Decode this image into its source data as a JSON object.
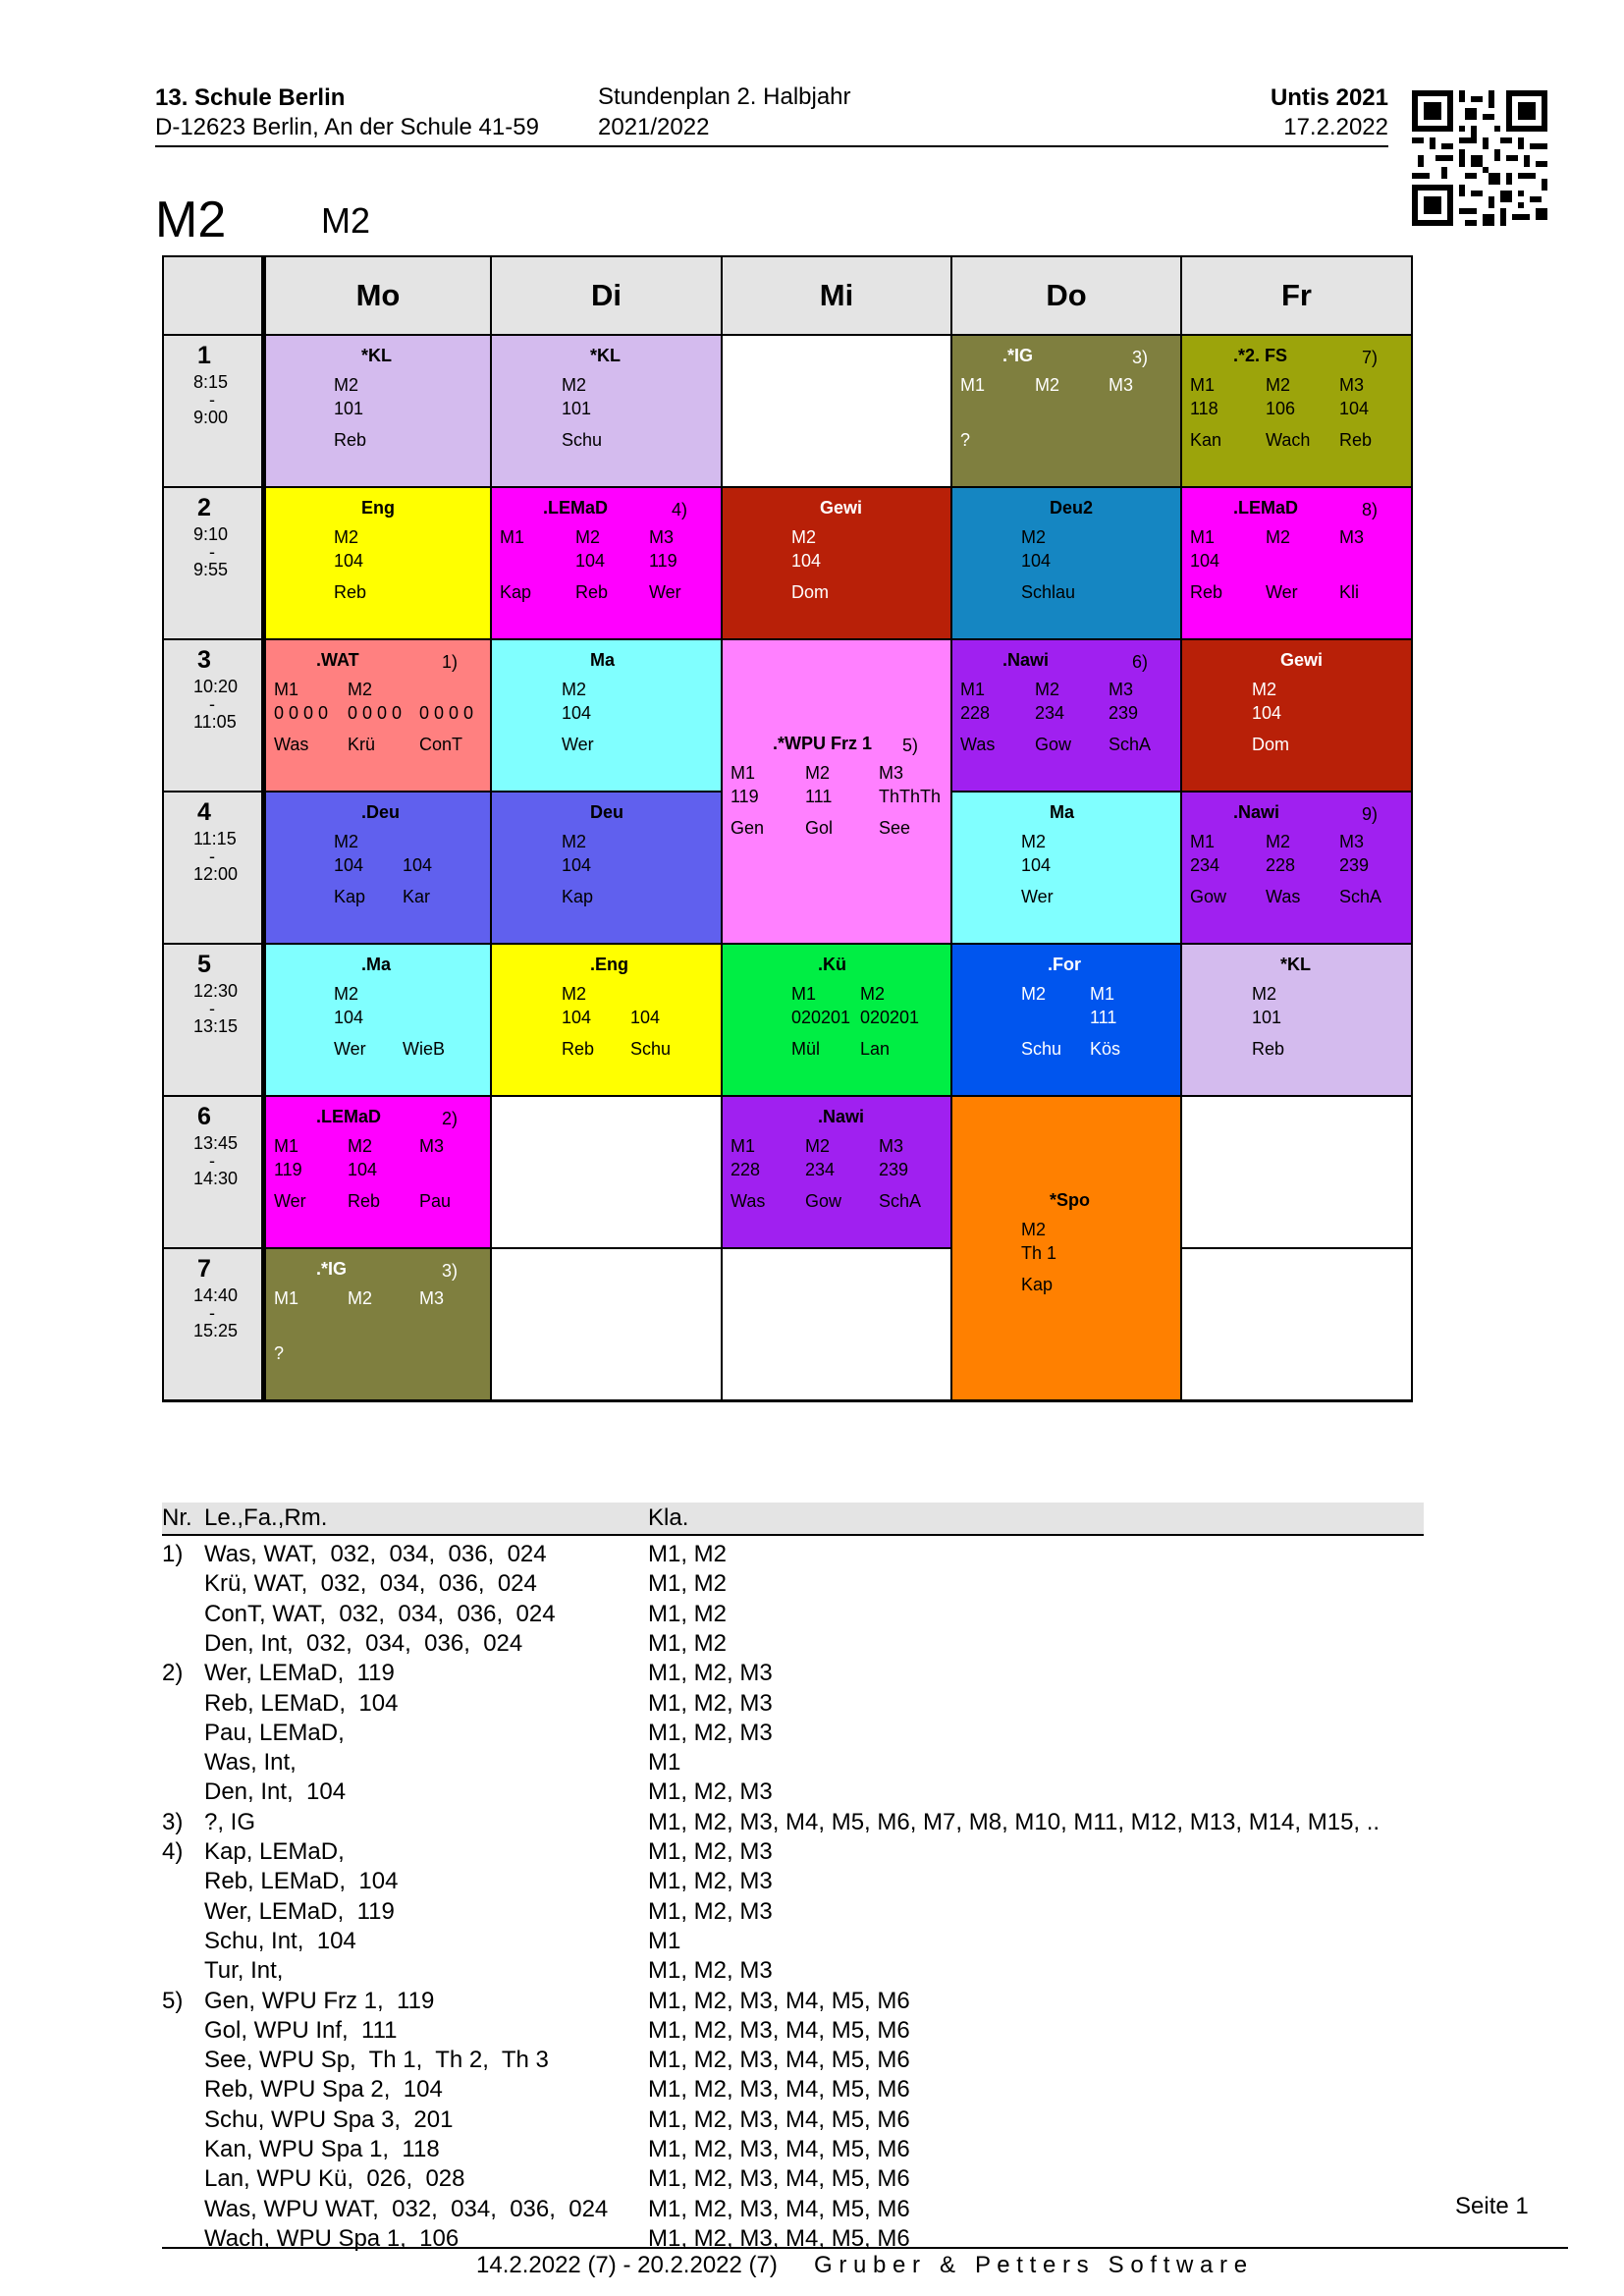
{
  "header": {
    "school_name": "13. Schule Berlin",
    "school_address": "D-12623 Berlin, An der Schule 41-59",
    "doc_title": "Stundenplan 2. Halbjahr",
    "school_year": "2021/2022",
    "software": "Untis 2021",
    "print_date": "17.2.2022",
    "class_code": "M2",
    "class_name": "M2"
  },
  "days": [
    "Mo",
    "Di",
    "Mi",
    "Do",
    "Fr"
  ],
  "periods": [
    {
      "num": "1",
      "start": "8:15",
      "end": "9:00"
    },
    {
      "num": "2",
      "start": "9:10",
      "end": "9:55"
    },
    {
      "num": "3",
      "start": "10:20",
      "end": "11:05"
    },
    {
      "num": "4",
      "start": "11:15",
      "end": "12:00"
    },
    {
      "num": "5",
      "start": "12:30",
      "end": "13:15"
    },
    {
      "num": "6",
      "start": "13:45",
      "end": "14:30"
    },
    {
      "num": "7",
      "start": "14:40",
      "end": "15:25"
    }
  ],
  "period_dash": "-",
  "lessons": {
    "mo1": {
      "title": "*KL",
      "color": "#d4bbee",
      "l1": [
        "M2"
      ],
      "l2": [
        "101"
      ],
      "l3": [
        "Reb"
      ]
    },
    "di1": {
      "title": "*KL",
      "color": "#d4bbee",
      "l1": [
        "M2"
      ],
      "l2": [
        "101"
      ],
      "l3": [
        "Schu"
      ]
    },
    "do1": {
      "title": ".*IG",
      "note": "3)",
      "color": "#7f7f3f",
      "l1": [
        "M1",
        "M2",
        "M3"
      ],
      "l3": [
        "?"
      ]
    },
    "fr1": {
      "title": ".*2. FS",
      "note": "7)",
      "color": "#9ca40b",
      "l1": [
        "M1",
        "M2",
        "M3"
      ],
      "l2": [
        "118",
        "106",
        "104"
      ],
      "l3": [
        "Kan",
        "Wach",
        "Reb"
      ]
    },
    "mo2": {
      "title": "Eng",
      "color": "#ffff00",
      "l1": [
        "M2"
      ],
      "l2": [
        "104"
      ],
      "l3": [
        "Reb"
      ]
    },
    "di2": {
      "title": ".LEMaD",
      "note": "4)",
      "color": "#ff00ff",
      "l1": [
        "M1",
        "M2",
        "M3"
      ],
      "l2": [
        "",
        "104",
        "119"
      ],
      "l3": [
        "Kap",
        "Reb",
        "Wer"
      ]
    },
    "mi2": {
      "title": "Gewi",
      "color": "#b82008",
      "l1": [
        "M2"
      ],
      "l2": [
        "104"
      ],
      "l3": [
        "Dom"
      ]
    },
    "do2": {
      "title": "Deu2",
      "color": "#1586c2",
      "l1": [
        "M2"
      ],
      "l2": [
        "104"
      ],
      "l3": [
        "Schlau"
      ]
    },
    "fr2": {
      "title": ".LEMaD",
      "note": "8)",
      "color": "#ff00ff",
      "l1": [
        "M1",
        "M2",
        "M3"
      ],
      "l2": [
        "104",
        "",
        ""
      ],
      "l3": [
        "Reb",
        "Wer",
        "Kli"
      ]
    },
    "mo3": {
      "title": ".WAT",
      "note": "1)",
      "color": "#ff8080",
      "l1": [
        "M1",
        "M2",
        ""
      ],
      "l2": [
        "0 0 0 0",
        "0 0 0 0",
        "0 0 0 0"
      ],
      "l3": [
        "Was",
        "Krü",
        "ConT"
      ]
    },
    "di3": {
      "title": "Ma",
      "color": "#80ffff",
      "l1": [
        "M2"
      ],
      "l2": [
        "104"
      ],
      "l3": [
        "Wer"
      ]
    },
    "mi3": {
      "title": ".*WPU Frz 1",
      "note": "5)",
      "color": "#ff80ff",
      "l1": [
        "M1",
        "M2",
        "M3"
      ],
      "l2": [
        "119",
        "111",
        "ThThTh"
      ],
      "l3": [
        "Gen",
        "Gol",
        "See"
      ]
    },
    "do3": {
      "title": ".Nawi",
      "note": "6)",
      "color": "#a020f0",
      "l1": [
        "M1",
        "M2",
        "M3"
      ],
      "l2": [
        "228",
        "234",
        "239"
      ],
      "l3": [
        "Was",
        "Gow",
        "SchA"
      ]
    },
    "fr3": {
      "title": "Gewi",
      "color": "#b82008",
      "l1": [
        "M2"
      ],
      "l2": [
        "104"
      ],
      "l3": [
        "Dom"
      ]
    },
    "mo4": {
      "title": ".Deu",
      "color": "#6060ee",
      "l1": [
        "M2"
      ],
      "l2": [
        "104",
        "104"
      ],
      "l3": [
        "Kap",
        "Kar"
      ]
    },
    "di4": {
      "title": "Deu",
      "color": "#6060ee",
      "l1": [
        "M2"
      ],
      "l2": [
        "104"
      ],
      "l3": [
        "Kap"
      ]
    },
    "do4": {
      "title": "Ma",
      "color": "#80ffff",
      "l1": [
        "M2"
      ],
      "l2": [
        "104"
      ],
      "l3": [
        "Wer"
      ]
    },
    "fr4": {
      "title": ".Nawi",
      "note": "9)",
      "color": "#a020f0",
      "l1": [
        "M1",
        "M2",
        "M3"
      ],
      "l2": [
        "234",
        "228",
        "239"
      ],
      "l3": [
        "Gow",
        "Was",
        "SchA"
      ]
    },
    "mo5": {
      "title": ".Ma",
      "color": "#80ffff",
      "l1": [
        "M2"
      ],
      "l2": [
        "104"
      ],
      "l3": [
        "Wer",
        "WieB"
      ]
    },
    "di5": {
      "title": ".Eng",
      "color": "#ffff00",
      "l1": [
        "M2"
      ],
      "l2": [
        "104",
        "104"
      ],
      "l3": [
        "Reb",
        "Schu"
      ]
    },
    "mi5": {
      "title": ".Kü",
      "color": "#00ee44",
      "l1": [
        "M1",
        "M2"
      ],
      "l2": [
        "020201",
        "020201"
      ],
      "l3": [
        "Mül",
        "Lan"
      ]
    },
    "do5": {
      "title": ".For",
      "color": "#0055ee",
      "l1": [
        "M2",
        "M1"
      ],
      "l2": [
        "",
        "111"
      ],
      "l3": [
        "Schu",
        "Kös"
      ]
    },
    "fr5": {
      "title": "*KL",
      "color": "#d4bbee",
      "l1": [
        "M2"
      ],
      "l2": [
        "101"
      ],
      "l3": [
        "Reb"
      ]
    },
    "mo6": {
      "title": ".LEMaD",
      "note": "2)",
      "color": "#ff00ff",
      "l1": [
        "M1",
        "M2",
        "M3"
      ],
      "l2": [
        "119",
        "104",
        ""
      ],
      "l3": [
        "Wer",
        "Reb",
        "Pau"
      ]
    },
    "mi6": {
      "title": ".Nawi",
      "color": "#a020f0",
      "l1": [
        "M1",
        "M2",
        "M3"
      ],
      "l2": [
        "228",
        "234",
        "239"
      ],
      "l3": [
        "Was",
        "Gow",
        "SchA"
      ]
    },
    "do6": {
      "title": "*Spo",
      "color": "#ff8000",
      "l1": [
        "M2"
      ],
      "l2": [
        "Th 1"
      ],
      "l3": [
        "Kap"
      ]
    },
    "mo7": {
      "title": ".*IG",
      "note": "3)",
      "color": "#7f7f3f",
      "l1": [
        "M1",
        "M2",
        "M3"
      ],
      "l3": [
        "?"
      ]
    }
  },
  "legend": {
    "col_nr": "Nr.",
    "col_teacher": "Le.,Fa.,Rm.",
    "col_class": "Kla.",
    "rows": [
      {
        "nr": "1)",
        "text": "Was, WAT,  032,  034,  036,  024",
        "kla": "M1, M2"
      },
      {
        "nr": "",
        "text": "Krü, WAT,  032,  034,  036,  024",
        "kla": "M1, M2"
      },
      {
        "nr": "",
        "text": "ConT, WAT,  032,  034,  036,  024",
        "kla": "M1, M2"
      },
      {
        "nr": "",
        "text": "Den, Int,  032,  034,  036,  024",
        "kla": "M1, M2"
      },
      {
        "nr": "2)",
        "text": "Wer, LEMaD,  119",
        "kla": "M1, M2, M3"
      },
      {
        "nr": "",
        "text": "Reb, LEMaD,  104",
        "kla": "M1, M2, M3"
      },
      {
        "nr": "",
        "text": "Pau, LEMaD,",
        "kla": "M1, M2, M3"
      },
      {
        "nr": "",
        "text": "Was, Int,",
        "kla": "M1"
      },
      {
        "nr": "",
        "text": "Den, Int,  104",
        "kla": "M1, M2, M3"
      },
      {
        "nr": "3)",
        "text": "?, IG",
        "kla": "M1, M2, M3, M4, M5, M6, M7, M8, M10, M11, M12, M13, M14, M15, .."
      },
      {
        "nr": "4)",
        "text": "Kap, LEMaD,",
        "kla": "M1, M2, M3"
      },
      {
        "nr": "",
        "text": "Reb, LEMaD,  104",
        "kla": "M1, M2, M3"
      },
      {
        "nr": "",
        "text": "Wer, LEMaD,  119",
        "kla": "M1, M2, M3"
      },
      {
        "nr": "",
        "text": "Schu, Int,  104",
        "kla": "M1"
      },
      {
        "nr": "",
        "text": "Tur, Int,",
        "kla": "M1, M2, M3"
      },
      {
        "nr": "5)",
        "text": "Gen, WPU Frz 1,  119",
        "kla": "M1, M2, M3, M4, M5, M6"
      },
      {
        "nr": "",
        "text": "Gol, WPU Inf,  111",
        "kla": "M1, M2, M3, M4, M5, M6"
      },
      {
        "nr": "",
        "text": "See, WPU Sp,  Th 1,  Th 2,  Th 3",
        "kla": "M1, M2, M3, M4, M5, M6"
      },
      {
        "nr": "",
        "text": "Reb, WPU Spa 2,  104",
        "kla": "M1, M2, M3, M4, M5, M6"
      },
      {
        "nr": "",
        "text": "Schu, WPU Spa 3,  201",
        "kla": "M1, M2, M3, M4, M5, M6"
      },
      {
        "nr": "",
        "text": "Kan, WPU Spa 1,  118",
        "kla": "M1, M2, M3, M4, M5, M6"
      },
      {
        "nr": "",
        "text": "Lan, WPU Kü,  026,  028",
        "kla": "M1, M2, M3, M4, M5, M6"
      },
      {
        "nr": "",
        "text": "Was, WPU WAT,  032,  034,  036,  024",
        "kla": "M1, M2, M3, M4, M5, M6"
      },
      {
        "nr": "",
        "text": "Wach, WPU Spa 1,  106",
        "kla": "M1, M2, M3, M4, M5, M6"
      }
    ]
  },
  "footer": {
    "page": "Seite 1",
    "range": "14.2.2022 (7) - 20.2.2022 (7)",
    "vendor": "G r u b e r   &   P e t t e r s   S o f t w a r e"
  }
}
